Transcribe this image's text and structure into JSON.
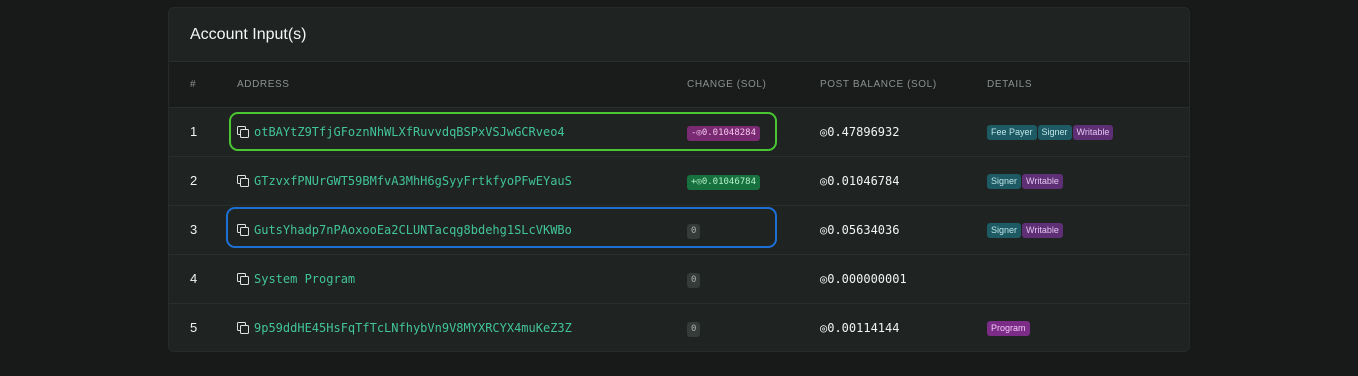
{
  "card": {
    "title": "Account Input(s)"
  },
  "columns": [
    "#",
    "ADDRESS",
    "CHANGE (SOL)",
    "POST BALANCE (SOL)",
    "DETAILS"
  ],
  "rows": [
    {
      "index": "1",
      "address": "otBAYtZ9TfjGFoznNhWLXfRuvvdqBSPxVSJwGCRveo4",
      "change": "-◎0.01048284",
      "change_type": "negative",
      "post_balance": "◎0.47896932",
      "details": [
        "Fee Payer",
        "Signer",
        "Writable"
      ]
    },
    {
      "index": "2",
      "address": "GTzvxfPNUrGWT59BMfvA3MhH6gSyyFrtkfyoPFwEYauS",
      "change": "+◎0.01046784",
      "change_type": "positive",
      "post_balance": "◎0.01046784",
      "details": [
        "Signer",
        "Writable"
      ]
    },
    {
      "index": "3",
      "address": "GutsYhadp7nPAoxooEa2CLUNTacqg8bdehg1SLcVKWBo",
      "change": "0",
      "change_type": "zero",
      "post_balance": "◎0.05634036",
      "details": [
        "Signer",
        "Writable"
      ]
    },
    {
      "index": "4",
      "address": "System Program",
      "change": "0",
      "change_type": "zero",
      "post_balance": "◎0.000000001",
      "details": []
    },
    {
      "index": "5",
      "address": "9p59ddHE45HsFqTfTcLNfhybVn9V8MYXRCYX4muKeZ3Z",
      "change": "0",
      "change_type": "zero",
      "post_balance": "◎0.00114144",
      "details": [
        "Program"
      ]
    }
  ],
  "highlights": [
    {
      "row": "1",
      "color": "#49c631"
    },
    {
      "row": "3",
      "color": "#1e6fd3"
    }
  ],
  "colors": {
    "background": "#171a19",
    "card": "#1f2322",
    "address": "#42c49a",
    "negative_badge": "#7a2a72",
    "positive_badge": "#16713f",
    "signer_tag": "#1d5a63",
    "writable_tag": "#5e2f74"
  }
}
